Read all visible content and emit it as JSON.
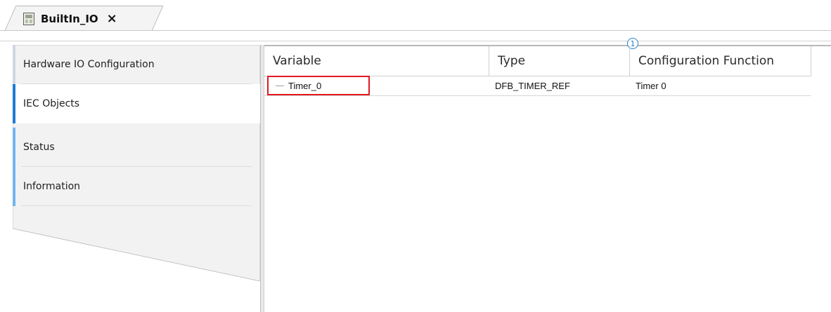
{
  "document_tab": {
    "title": "BuiltIn_IO",
    "close_glyph": "×",
    "icon": "device-module-icon"
  },
  "sidebar": {
    "items": [
      {
        "label": "Hardware IO Configuration",
        "accent": "#d0d7e2"
      },
      {
        "label": "IEC Objects",
        "accent": "#1e7ad6",
        "active": true
      },
      {
        "label": "Status",
        "accent": "#6fb6ef"
      },
      {
        "label": "Information",
        "accent": "#6fb6ef"
      }
    ]
  },
  "table": {
    "annotation_marker": "1",
    "columns": [
      "Variable",
      "Type",
      "Configuration Function"
    ],
    "rows": [
      {
        "variable": "Timer_0",
        "type": "DFB_TIMER_REF",
        "function": "Timer 0"
      }
    ]
  },
  "colors": {
    "highlight": "#e0191f",
    "marker": "#2a7fc6"
  }
}
